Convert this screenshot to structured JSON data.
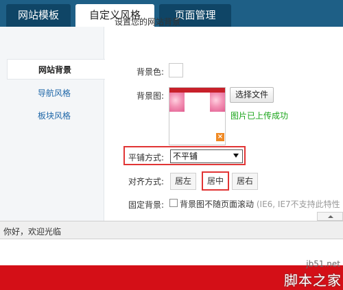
{
  "tabs": [
    {
      "label": "网站模板"
    },
    {
      "label": "自定义风格"
    },
    {
      "label": "页面管理"
    }
  ],
  "sidebar": {
    "items": [
      {
        "label": "网站背景"
      },
      {
        "label": "导航风格"
      },
      {
        "label": "板块风格"
      }
    ]
  },
  "form": {
    "title": "设置您的网站背景",
    "bg_color_label": "背景色:",
    "bg_image_label": "背景图:",
    "choose_file_label": "选择文件",
    "upload_success": "图片已上传成功",
    "delete_icon": "×",
    "repeat_label": "平铺方式:",
    "repeat_value": "不平铺",
    "align_label": "对齐方式:",
    "align_options": [
      "居左",
      "居中",
      "居右"
    ],
    "align_selected": "居中",
    "fixed_label": "固定背景:",
    "fixed_checkbox_text": "背景图不随页面滚动",
    "fixed_hint": "(IE6, IE7不支持此特性"
  },
  "status": {
    "welcome": "你好，欢迎光临"
  },
  "watermark": {
    "url": "jb51.net",
    "name": "脚本之家"
  },
  "colors": {
    "tab_bar": "#1e5f86",
    "footer": "#d40f17",
    "highlight": "#e13434",
    "success": "#1aa51a",
    "link": "#1f67a8"
  },
  "icons": {
    "delete": "close-icon",
    "dropdown": "chevron-down-icon",
    "scroll": "chevron-up-icon"
  }
}
